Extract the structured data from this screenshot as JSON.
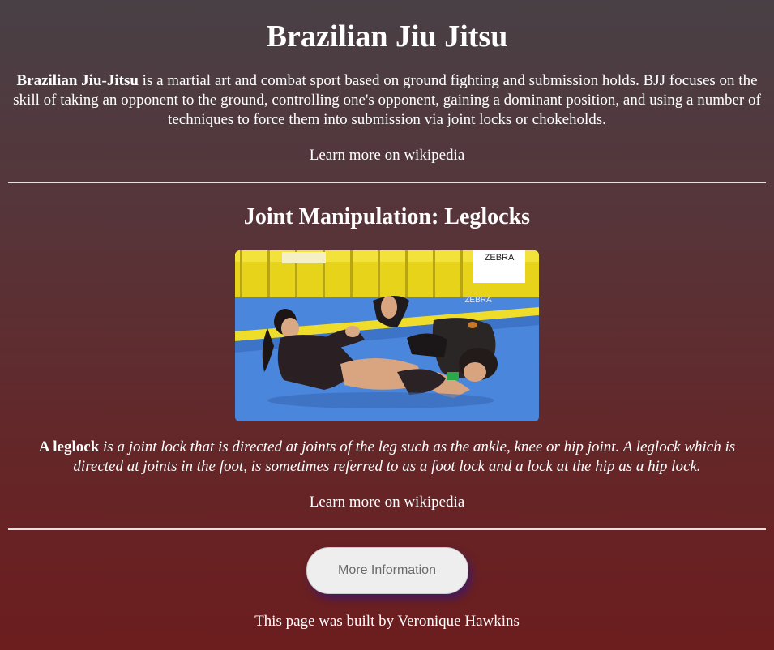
{
  "header": {
    "title": "Brazilian Jiu Jitsu"
  },
  "intro": {
    "term": "Brazilian Jiu-Jitsu",
    "text": " is a martial art and combat sport based on ground fighting and submission holds. BJJ focuses on the skill of taking an opponent to the ground, controlling one's opponent, gaining a dominant position, and using a number of techniques to force them into submission via joint locks or chokeholds.",
    "link_label": "Learn more on wikipedia"
  },
  "section": {
    "title": "Joint Manipulation: Leglocks",
    "image_banner": "ZEBRA",
    "image_mat_text": "ZEBRA",
    "term": "A leglock",
    "text": " is a joint lock that is directed at joints of the leg such as the ankle, knee or hip joint. A leglock which is directed at joints in the foot, is sometimes referred to as a foot lock and a lock at the hip as a hip lock.",
    "link_label": "Learn more on wikipedia"
  },
  "more_button": {
    "label": "More Information"
  },
  "footer": {
    "text": "This page was built by Veronique Hawkins"
  }
}
